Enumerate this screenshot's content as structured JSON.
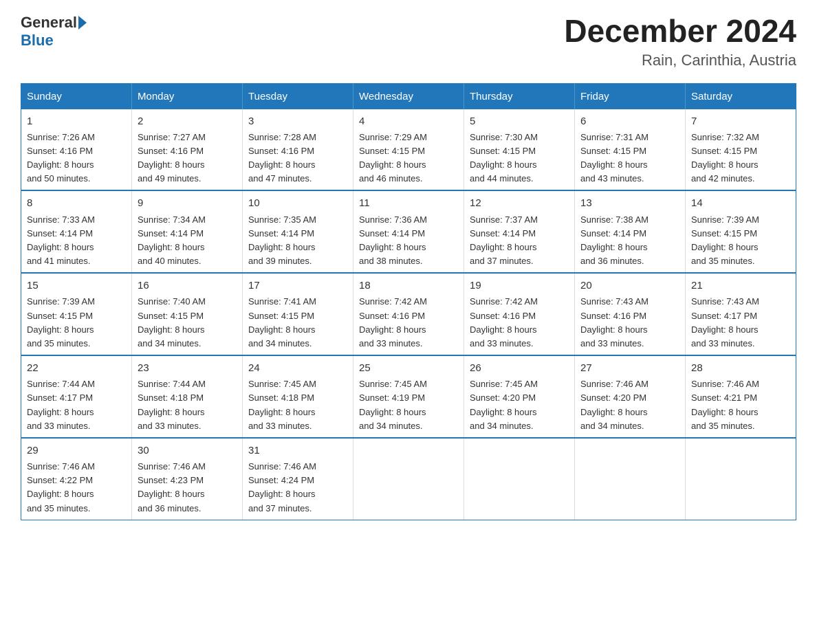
{
  "header": {
    "logo_general": "General",
    "logo_blue": "Blue",
    "title": "December 2024",
    "subtitle": "Rain, Carinthia, Austria"
  },
  "calendar": {
    "weekdays": [
      "Sunday",
      "Monday",
      "Tuesday",
      "Wednesday",
      "Thursday",
      "Friday",
      "Saturday"
    ],
    "weeks": [
      [
        {
          "day": "1",
          "sunrise": "7:26 AM",
          "sunset": "4:16 PM",
          "daylight": "8 hours and 50 minutes."
        },
        {
          "day": "2",
          "sunrise": "7:27 AM",
          "sunset": "4:16 PM",
          "daylight": "8 hours and 49 minutes."
        },
        {
          "day": "3",
          "sunrise": "7:28 AM",
          "sunset": "4:16 PM",
          "daylight": "8 hours and 47 minutes."
        },
        {
          "day": "4",
          "sunrise": "7:29 AM",
          "sunset": "4:15 PM",
          "daylight": "8 hours and 46 minutes."
        },
        {
          "day": "5",
          "sunrise": "7:30 AM",
          "sunset": "4:15 PM",
          "daylight": "8 hours and 44 minutes."
        },
        {
          "day": "6",
          "sunrise": "7:31 AM",
          "sunset": "4:15 PM",
          "daylight": "8 hours and 43 minutes."
        },
        {
          "day": "7",
          "sunrise": "7:32 AM",
          "sunset": "4:15 PM",
          "daylight": "8 hours and 42 minutes."
        }
      ],
      [
        {
          "day": "8",
          "sunrise": "7:33 AM",
          "sunset": "4:14 PM",
          "daylight": "8 hours and 41 minutes."
        },
        {
          "day": "9",
          "sunrise": "7:34 AM",
          "sunset": "4:14 PM",
          "daylight": "8 hours and 40 minutes."
        },
        {
          "day": "10",
          "sunrise": "7:35 AM",
          "sunset": "4:14 PM",
          "daylight": "8 hours and 39 minutes."
        },
        {
          "day": "11",
          "sunrise": "7:36 AM",
          "sunset": "4:14 PM",
          "daylight": "8 hours and 38 minutes."
        },
        {
          "day": "12",
          "sunrise": "7:37 AM",
          "sunset": "4:14 PM",
          "daylight": "8 hours and 37 minutes."
        },
        {
          "day": "13",
          "sunrise": "7:38 AM",
          "sunset": "4:14 PM",
          "daylight": "8 hours and 36 minutes."
        },
        {
          "day": "14",
          "sunrise": "7:39 AM",
          "sunset": "4:15 PM",
          "daylight": "8 hours and 35 minutes."
        }
      ],
      [
        {
          "day": "15",
          "sunrise": "7:39 AM",
          "sunset": "4:15 PM",
          "daylight": "8 hours and 35 minutes."
        },
        {
          "day": "16",
          "sunrise": "7:40 AM",
          "sunset": "4:15 PM",
          "daylight": "8 hours and 34 minutes."
        },
        {
          "day": "17",
          "sunrise": "7:41 AM",
          "sunset": "4:15 PM",
          "daylight": "8 hours and 34 minutes."
        },
        {
          "day": "18",
          "sunrise": "7:42 AM",
          "sunset": "4:16 PM",
          "daylight": "8 hours and 33 minutes."
        },
        {
          "day": "19",
          "sunrise": "7:42 AM",
          "sunset": "4:16 PM",
          "daylight": "8 hours and 33 minutes."
        },
        {
          "day": "20",
          "sunrise": "7:43 AM",
          "sunset": "4:16 PM",
          "daylight": "8 hours and 33 minutes."
        },
        {
          "day": "21",
          "sunrise": "7:43 AM",
          "sunset": "4:17 PM",
          "daylight": "8 hours and 33 minutes."
        }
      ],
      [
        {
          "day": "22",
          "sunrise": "7:44 AM",
          "sunset": "4:17 PM",
          "daylight": "8 hours and 33 minutes."
        },
        {
          "day": "23",
          "sunrise": "7:44 AM",
          "sunset": "4:18 PM",
          "daylight": "8 hours and 33 minutes."
        },
        {
          "day": "24",
          "sunrise": "7:45 AM",
          "sunset": "4:18 PM",
          "daylight": "8 hours and 33 minutes."
        },
        {
          "day": "25",
          "sunrise": "7:45 AM",
          "sunset": "4:19 PM",
          "daylight": "8 hours and 34 minutes."
        },
        {
          "day": "26",
          "sunrise": "7:45 AM",
          "sunset": "4:20 PM",
          "daylight": "8 hours and 34 minutes."
        },
        {
          "day": "27",
          "sunrise": "7:46 AM",
          "sunset": "4:20 PM",
          "daylight": "8 hours and 34 minutes."
        },
        {
          "day": "28",
          "sunrise": "7:46 AM",
          "sunset": "4:21 PM",
          "daylight": "8 hours and 35 minutes."
        }
      ],
      [
        {
          "day": "29",
          "sunrise": "7:46 AM",
          "sunset": "4:22 PM",
          "daylight": "8 hours and 35 minutes."
        },
        {
          "day": "30",
          "sunrise": "7:46 AM",
          "sunset": "4:23 PM",
          "daylight": "8 hours and 36 minutes."
        },
        {
          "day": "31",
          "sunrise": "7:46 AM",
          "sunset": "4:24 PM",
          "daylight": "8 hours and 37 minutes."
        },
        null,
        null,
        null,
        null
      ]
    ]
  },
  "labels": {
    "sunrise": "Sunrise:",
    "sunset": "Sunset:",
    "daylight": "Daylight:"
  }
}
